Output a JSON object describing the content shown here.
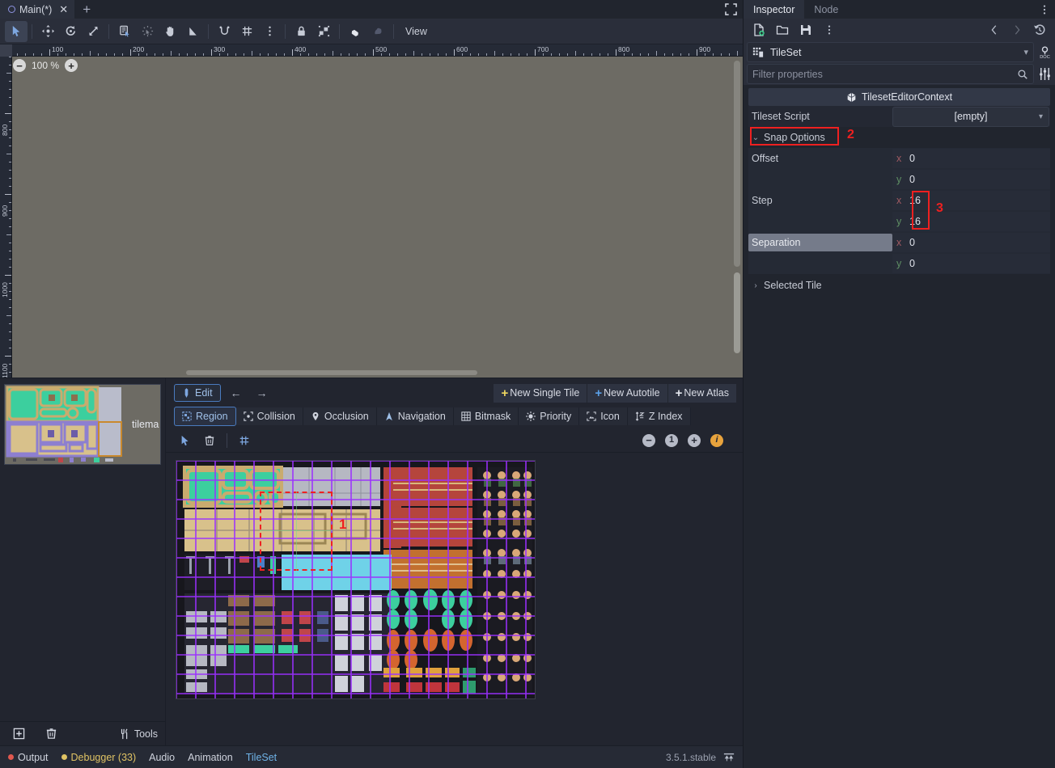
{
  "scene_tabs": {
    "tabs": [
      {
        "label": "Main(*)",
        "close": "✕"
      }
    ],
    "add": "+"
  },
  "main_toolbar": {
    "icons": [
      {
        "name": "select-tool",
        "active": true
      },
      {
        "name": "move-tool",
        "active": false
      },
      {
        "name": "rotate-tool",
        "active": false
      },
      {
        "name": "scale-tool",
        "active": false
      },
      {
        "name": "list-select-tool",
        "active": false
      },
      {
        "name": "ruler-click-tool",
        "active": false
      },
      {
        "name": "pan-tool",
        "active": false
      },
      {
        "name": "ruler-tool",
        "active": false
      },
      {
        "name": "snap-mode-icon",
        "active": false
      },
      {
        "name": "grid-snap-icon",
        "active": false
      },
      {
        "name": "snap-options-menu-icon",
        "active": false
      },
      {
        "name": "lock-icon",
        "active": false
      },
      {
        "name": "group-icon",
        "active": false
      },
      {
        "name": "bone-icon",
        "active": false
      },
      {
        "name": "skeleton-icon",
        "active": false
      }
    ],
    "view_label": "View"
  },
  "viewport": {
    "zoom_out": "−",
    "zoom_level": "100 %",
    "zoom_in": "+",
    "ruler_h_labels": [
      "100",
      "200",
      "300",
      "400",
      "500",
      "600",
      "700",
      "800",
      "900"
    ],
    "ruler_v_labels": [
      "800",
      "900",
      "1000",
      "1100"
    ]
  },
  "tileset_list": {
    "items": [
      {
        "name": "tilema",
        "selected": true
      }
    ],
    "add_icon": "add-tile-icon",
    "delete_icon": "trash-icon",
    "tools_label": "Tools"
  },
  "tileset_editor": {
    "edit_button": "Edit",
    "back_arrow": "←",
    "forward_arrow": "→",
    "new_buttons": [
      {
        "label": "New Single Tile",
        "plus_color": "#f0d860"
      },
      {
        "label": "New Autotile",
        "plus_color": "#5aa0e8"
      },
      {
        "label": "New Atlas",
        "plus_color": "#e4e7ee"
      }
    ],
    "mode_tabs": [
      {
        "label": "Region",
        "icon": "region-icon",
        "active": true
      },
      {
        "label": "Collision",
        "icon": "collision-icon",
        "active": false
      },
      {
        "label": "Occlusion",
        "icon": "occlusion-icon",
        "active": false
      },
      {
        "label": "Navigation",
        "icon": "navigation-icon",
        "active": false
      },
      {
        "label": "Bitmask",
        "icon": "bitmask-icon",
        "active": false
      },
      {
        "label": "Priority",
        "icon": "priority-icon",
        "active": false
      },
      {
        "label": "Icon",
        "icon": "icon-icon",
        "active": false
      },
      {
        "label": "Z Index",
        "icon": "zindex-icon",
        "active": false
      }
    ],
    "canvas_tools": [
      {
        "name": "select-cursor-icon",
        "active": true
      },
      {
        "name": "trash-icon",
        "active": false
      },
      {
        "name": "snap-grid-icon",
        "active": false
      }
    ],
    "zoom_controls": [
      {
        "name": "zoom-out-icon",
        "glyph": "−"
      },
      {
        "name": "zoom-reset-icon",
        "glyph": "1"
      },
      {
        "name": "zoom-in-icon",
        "glyph": "+"
      },
      {
        "name": "info-warning-icon",
        "glyph": "i"
      }
    ]
  },
  "annotations": [
    {
      "id": "1",
      "label": "1"
    },
    {
      "id": "2",
      "label": "2"
    },
    {
      "id": "3",
      "label": "3"
    }
  ],
  "statusbar": {
    "items": [
      {
        "label": "Output",
        "dot": "#e0584f",
        "active": false
      },
      {
        "label": "Debugger (33)",
        "dot": "#e0c364",
        "active": false
      },
      {
        "label": "Audio",
        "dot": null,
        "active": false
      },
      {
        "label": "Animation",
        "dot": null,
        "active": false
      },
      {
        "label": "TileSet",
        "dot": null,
        "active": true
      }
    ],
    "version": "3.5.1.stable",
    "expand_icon": "expand-bottom-panel-icon"
  },
  "inspector": {
    "tabs": [
      {
        "label": "Inspector",
        "active": true
      },
      {
        "label": "Node",
        "active": false
      }
    ],
    "menu_icon": "vertical-dots-icon",
    "toolbar_icons": [
      {
        "name": "new-resource-icon"
      },
      {
        "name": "open-resource-icon"
      },
      {
        "name": "save-resource-icon"
      },
      {
        "name": "resource-extra-menu-icon"
      },
      {
        "name": "history-prev-icon"
      },
      {
        "name": "history-next-icon"
      },
      {
        "name": "history-icon"
      }
    ],
    "object_name": "TileSet",
    "object_icon": "tileset-icon",
    "object_chevron": "⌄",
    "doc_icon": "open-docs-icon",
    "settings_icon": "object-settings-icon",
    "filter_placeholder": "Filter properties",
    "search_icon": "search-icon",
    "category": {
      "label": "TilesetEditorContext",
      "icon": "object-cube-icon"
    },
    "properties": [
      {
        "label": "Tileset Script",
        "type": "dropdown",
        "value": "[empty]",
        "chevron": "⌄"
      },
      {
        "label": "Snap Options",
        "type": "section",
        "expanded": true,
        "arrow": "⌄",
        "annotation": "2"
      },
      {
        "label": "Offset",
        "type": "vector2",
        "fields": [
          {
            "axis": "x",
            "value": "0"
          },
          {
            "axis": "y",
            "value": "0"
          }
        ]
      },
      {
        "label": "Step",
        "type": "vector2",
        "annotation": "3",
        "highlight_values": true,
        "fields": [
          {
            "axis": "x",
            "value": "16"
          },
          {
            "axis": "y",
            "value": "16"
          }
        ]
      },
      {
        "label": "Separation",
        "type": "vector2",
        "label_highlight": true,
        "fields": [
          {
            "axis": "x",
            "value": "0"
          },
          {
            "axis": "y",
            "value": "0"
          }
        ]
      },
      {
        "label": "Selected Tile",
        "type": "section",
        "expanded": false,
        "arrow": "›"
      }
    ]
  },
  "colors": {
    "accent": "#6fb3e8",
    "annotation_red": "#ee2020",
    "grid_purple": "#9b30ff",
    "panel_bg": "#21252e",
    "toolbar_bg": "#2a2e3a",
    "viewport_gray": "#6d6b64"
  }
}
